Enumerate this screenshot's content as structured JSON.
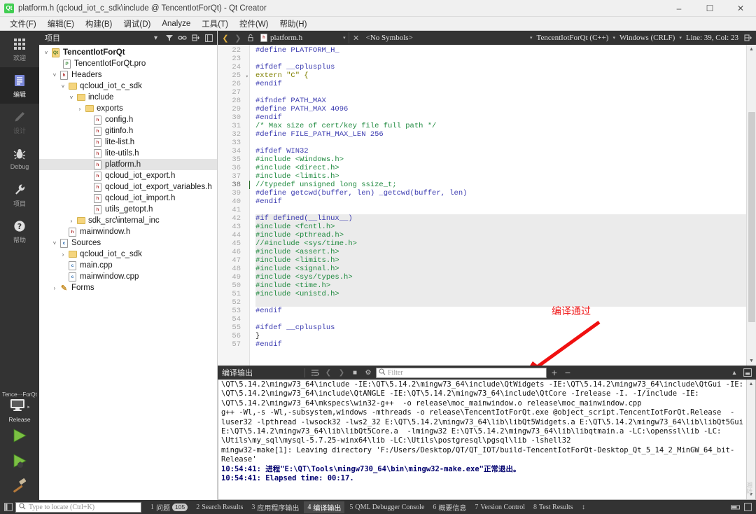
{
  "window": {
    "title": "platform.h (qcloud_iot_c_sdk\\include @ TencentIotForQt) - Qt Creator",
    "app_icon": "qt-logo-icon",
    "minimize": "–",
    "maximize": "☐",
    "close": "✕"
  },
  "menubar": {
    "items": [
      {
        "label": "文件(F)"
      },
      {
        "label": "编辑(E)"
      },
      {
        "label": "构建(B)"
      },
      {
        "label": "调试(D)"
      },
      {
        "label": "Analyze"
      },
      {
        "label": "工具(T)"
      },
      {
        "label": "控件(W)"
      },
      {
        "label": "帮助(H)"
      }
    ]
  },
  "modebar": {
    "modes": [
      {
        "label": "欢迎",
        "icon": "grid-icon",
        "state": "normal"
      },
      {
        "label": "编辑",
        "icon": "edit-document-icon",
        "state": "active"
      },
      {
        "label": "设计",
        "icon": "pencil-icon",
        "state": "disabled"
      },
      {
        "label": "Debug",
        "icon": "bug-icon",
        "state": "normal"
      },
      {
        "label": "项目",
        "icon": "wrench-icon",
        "state": "normal"
      },
      {
        "label": "帮助",
        "icon": "question-mark-icon",
        "state": "normal"
      }
    ],
    "kit": {
      "project_name": "Tence···ForQt",
      "build_config": "Release",
      "target_icon": "desktop-monitor-icon"
    },
    "actions": [
      {
        "name": "run-button",
        "icon": "green-play-icon"
      },
      {
        "name": "debug-button",
        "icon": "green-play-bug-icon"
      },
      {
        "name": "build-button",
        "icon": "hammer-icon"
      }
    ]
  },
  "project_panel": {
    "title": "项目",
    "header_icons": [
      "chevron-down-icon",
      "filter-icon",
      "link-icon",
      "split-icon",
      "close-panel-icon"
    ],
    "tree": [
      {
        "indent": 0,
        "chev": "˅",
        "icon": "qt-project-icon",
        "label": "TencentIotForQt",
        "bold": true
      },
      {
        "indent": 1,
        "chev": "",
        "icon": "pro-file-icon",
        "label": "TencentIotForQt.pro"
      },
      {
        "indent": 1,
        "chev": "˅",
        "icon": "headers-icon",
        "label": "Headers"
      },
      {
        "indent": 2,
        "chev": "˅",
        "icon": "folder-icon",
        "label": "qcloud_iot_c_sdk"
      },
      {
        "indent": 3,
        "chev": "˅",
        "icon": "folder-icon",
        "label": "include"
      },
      {
        "indent": 4,
        "chev": "›",
        "icon": "folder-icon",
        "label": "exports"
      },
      {
        "indent": 4,
        "chev": "",
        "icon": "h-file-icon",
        "label": "config.h"
      },
      {
        "indent": 4,
        "chev": "",
        "icon": "h-file-icon",
        "label": "gitinfo.h"
      },
      {
        "indent": 4,
        "chev": "",
        "icon": "h-file-icon",
        "label": "lite-list.h"
      },
      {
        "indent": 4,
        "chev": "",
        "icon": "h-file-icon",
        "label": "lite-utils.h"
      },
      {
        "indent": 4,
        "chev": "",
        "icon": "h-file-icon",
        "label": "platform.h",
        "selected": true
      },
      {
        "indent": 4,
        "chev": "",
        "icon": "h-file-icon",
        "label": "qcloud_iot_export.h"
      },
      {
        "indent": 4,
        "chev": "",
        "icon": "h-file-icon",
        "label": "qcloud_iot_export_variables.h"
      },
      {
        "indent": 4,
        "chev": "",
        "icon": "h-file-icon",
        "label": "qcloud_iot_import.h"
      },
      {
        "indent": 4,
        "chev": "",
        "icon": "h-file-icon",
        "label": "utils_getopt.h"
      },
      {
        "indent": 3,
        "chev": "›",
        "icon": "folder-icon",
        "label": "sdk_src\\internal_inc"
      },
      {
        "indent": 2,
        "chev": "",
        "icon": "h-file-icon",
        "label": "mainwindow.h"
      },
      {
        "indent": 1,
        "chev": "˅",
        "icon": "sources-icon",
        "label": "Sources"
      },
      {
        "indent": 2,
        "chev": "›",
        "icon": "folder-icon",
        "label": "qcloud_iot_c_sdk"
      },
      {
        "indent": 2,
        "chev": "",
        "icon": "cpp-file-icon",
        "label": "main.cpp"
      },
      {
        "indent": 2,
        "chev": "",
        "icon": "cpp-file-icon",
        "label": "mainwindow.cpp"
      },
      {
        "indent": 1,
        "chev": "›",
        "icon": "forms-icon",
        "label": "Forms"
      }
    ]
  },
  "editor_toolbar": {
    "back_icon": "back-chevron-icon",
    "forward_icon": "forward-chevron-icon",
    "lock_icon": "unlocked-icon",
    "file_icon": "h-file-icon",
    "file_name": "platform.h",
    "symbols": "<No Symbols>",
    "close_icon": "close-document-icon",
    "context": "TencentIotForQt (C++)",
    "line_ending": "Windows (CRLF)",
    "cursor_position": "Line: 39, Col: 23",
    "split_icon": "split-editor-icon"
  },
  "code": {
    "lines": [
      {
        "n": 22,
        "text": "#define PLATFORM_H_",
        "cls": "k-pre"
      },
      {
        "n": 23,
        "text": ""
      },
      {
        "n": 24,
        "text": "#ifdef __cplusplus",
        "cls": "k-pre"
      },
      {
        "n": 25,
        "text": "extern \"C\" {",
        "cls": "k-kw",
        "fold": "▾"
      },
      {
        "n": 26,
        "text": "#endif",
        "cls": "k-pre"
      },
      {
        "n": 27,
        "text": ""
      },
      {
        "n": 28,
        "text": "#ifndef PATH_MAX",
        "cls": "k-pre"
      },
      {
        "n": 29,
        "text": "#define PATH_MAX 4096",
        "cls": "k-pre"
      },
      {
        "n": 30,
        "text": "#endif",
        "cls": "k-pre"
      },
      {
        "n": 31,
        "text": "/* Max size of cert/key file full path */",
        "cls": "k-com"
      },
      {
        "n": 32,
        "text": "#define FILE_PATH_MAX_LEN 256",
        "cls": "k-pre"
      },
      {
        "n": 33,
        "text": ""
      },
      {
        "n": 34,
        "text": "#ifdef WIN32",
        "cls": "k-pre"
      },
      {
        "n": 35,
        "text": "#include <Windows.h>",
        "cls": "k-inc"
      },
      {
        "n": 36,
        "text": "#include <direct.h>",
        "cls": "k-inc"
      },
      {
        "n": 37,
        "text": "#include <limits.h>",
        "cls": "k-inc"
      },
      {
        "n": 38,
        "text": "//typedef unsigned long ssize_t;",
        "cls": "k-com",
        "current": true
      },
      {
        "n": 39,
        "text": "#define getcwd(buffer, len) _getcwd(buffer, len)",
        "cls": "k-pre"
      },
      {
        "n": 40,
        "text": "#endif",
        "cls": "k-pre"
      },
      {
        "n": 41,
        "text": ""
      },
      {
        "n": 42,
        "text": "#if defined(__linux__)",
        "cls": "k-pre",
        "dim": true
      },
      {
        "n": 43,
        "text": "#include <fcntl.h>",
        "cls": "k-inc",
        "dim": true
      },
      {
        "n": 44,
        "text": "#include <pthread.h>",
        "cls": "k-inc",
        "dim": true
      },
      {
        "n": 45,
        "text": "//#include <sys/time.h>",
        "cls": "k-com",
        "dim": true
      },
      {
        "n": 46,
        "text": "#include <assert.h>",
        "cls": "k-inc",
        "dim": true
      },
      {
        "n": 47,
        "text": "#include <limits.h>",
        "cls": "k-inc",
        "dim": true
      },
      {
        "n": 48,
        "text": "#include <signal.h>",
        "cls": "k-inc",
        "dim": true
      },
      {
        "n": 49,
        "text": "#include <sys/types.h>",
        "cls": "k-inc",
        "dim": true
      },
      {
        "n": 50,
        "text": "#include <time.h>",
        "cls": "k-inc",
        "dim": true
      },
      {
        "n": 51,
        "text": "#include <unistd.h>",
        "cls": "k-inc",
        "dim": true
      },
      {
        "n": 52,
        "text": "",
        "dim": true
      },
      {
        "n": 53,
        "text": "#endif",
        "cls": "k-pre"
      },
      {
        "n": 54,
        "text": ""
      },
      {
        "n": 55,
        "text": "#ifdef __cplusplus",
        "cls": "k-pre"
      },
      {
        "n": 56,
        "text": "}"
      },
      {
        "n": 57,
        "text": "#endif",
        "cls": "k-pre"
      }
    ]
  },
  "annotation": {
    "text": "编译通过",
    "color": "#f01c1c",
    "arrow": "red-arrow-down-left"
  },
  "output_panel": {
    "title": "编译输出",
    "icons": [
      "word-wrap-icon",
      "prev-item-icon",
      "next-item-icon",
      "stop-icon",
      "settings-gear-icon"
    ],
    "filter_placeholder": "Filter",
    "search_icon": "search-icon",
    "zoom_in": "+",
    "zoom_out": "−",
    "minimize_icon": "chevron-up-icon",
    "maximize_icon": "maximize-panel-icon",
    "watermark": "減\\n转",
    "lines": [
      {
        "text": "\\QT\\5.14.2\\mingw73_64\\include -IE:\\QT\\5.14.2\\mingw73_64\\include\\QtWidgets -IE:\\QT\\5.14.2\\mingw73_64\\include\\QtGui -IE:"
      },
      {
        "text": "\\QT\\5.14.2\\mingw73_64\\include\\QtANGLE -IE:\\QT\\5.14.2\\mingw73_64\\include\\QtCore -Irelease -I. -I/include -IE:"
      },
      {
        "text": "\\QT\\5.14.2\\mingw73_64\\mkspecs\\win32-g++  -o release\\moc_mainwindow.o release\\moc_mainwindow.cpp"
      },
      {
        "text": "g++ -Wl,-s -Wl,-subsystem,windows -mthreads -o release\\TencentIotForQt.exe @object_script.TencentIotForQt.Release  -"
      },
      {
        "text": "luser32 -lpthread -lwsock32 -lws2_32 E:\\QT\\5.14.2\\mingw73_64\\lib\\libQt5Widgets.a E:\\QT\\5.14.2\\mingw73_64\\lib\\libQt5Gui.a"
      },
      {
        "text": "E:\\QT\\5.14.2\\mingw73_64\\lib\\libQt5Core.a  -lmingw32 E:\\QT\\5.14.2\\mingw73_64\\lib\\libqtmain.a -LC:\\openssl\\lib -LC:"
      },
      {
        "text": "\\Utils\\my_sql\\mysql-5.7.25-winx64\\lib -LC:\\Utils\\postgresql\\pgsql\\lib -lshell32"
      },
      {
        "text": "mingw32-make[1]: Leaving directory 'F:/Users/Desktop/QT/QT_IOT/build-TencentIotForQt-Desktop_Qt_5_14_2_MinGW_64_bit-"
      },
      {
        "text": "Release'"
      },
      {
        "text": "10:54:41: 进程\"E:\\QT\\Tools\\mingw730_64\\bin\\mingw32-make.exe\"正常退出。",
        "bold": true
      },
      {
        "text": "10:54:41: Elapsed time: 00:17.",
        "bold": true
      }
    ]
  },
  "statusbar": {
    "sidebar_toggle_icon": "sidebar-toggle-icon",
    "locator_placeholder": "Type to locate (Ctrl+K)",
    "search_icon": "search-icon",
    "tabs": [
      {
        "num": "1",
        "label": "问题",
        "badge": "105"
      },
      {
        "num": "2",
        "label": "Search Results"
      },
      {
        "num": "3",
        "label": "应用程序输出"
      },
      {
        "num": "4",
        "label": "编译输出",
        "active": true
      },
      {
        "num": "5",
        "label": "QML Debugger Console"
      },
      {
        "num": "6",
        "label": "概要信息"
      },
      {
        "num": "7",
        "label": "Version Control"
      },
      {
        "num": "8",
        "label": "Test Results"
      }
    ],
    "resize_icon": "resize-handle-icon",
    "right_icons": [
      "progress-icon",
      "output-toggle-icon"
    ]
  }
}
